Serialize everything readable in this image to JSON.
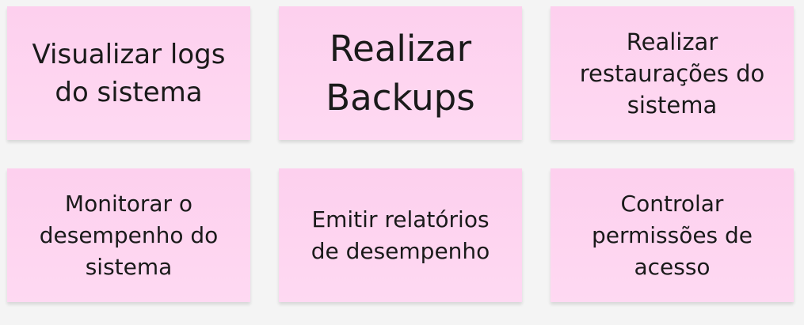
{
  "notes": [
    {
      "lines": [
        "Visualizar logs",
        "do sistema"
      ]
    },
    {
      "lines": [
        "Realizar",
        "Backups"
      ]
    },
    {
      "lines": [
        "Realizar",
        "restaurações do",
        "sistema"
      ]
    },
    {
      "lines": [
        "Monitorar o",
        "desempenho do",
        "sistema"
      ]
    },
    {
      "lines": [
        "Emitir relatórios",
        "de desempenho"
      ]
    },
    {
      "lines": [
        "Controlar",
        "permissões de",
        "acesso"
      ]
    }
  ],
  "colors": {
    "note": "#fdd3ef",
    "background": "#f4f4f4"
  }
}
